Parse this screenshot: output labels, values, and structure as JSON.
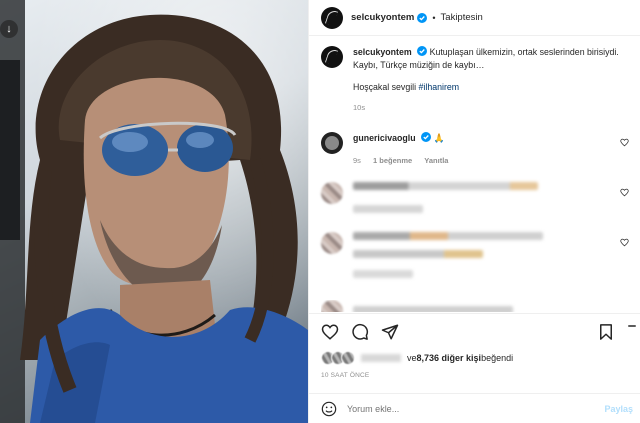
{
  "header": {
    "username": "selcukyontem",
    "separator": "•",
    "follow_label": "Takiptesin",
    "avatar_icon": "signature-avatar",
    "verified_icon": "verified-badge-icon"
  },
  "caption": {
    "username": "selcukyontem",
    "text": "Kutuplaşan ülkemizin, ortak seslerinden birisiydi. Kaybı, Türkçe müziğin de kaybı…",
    "line2_prefix": "Hoşçakal sevgili ",
    "hashtag": "#ilhanirem",
    "time": "10s"
  },
  "comments": [
    {
      "username": "gunericivaoglu",
      "text": "🙏",
      "time": "9s",
      "likes": "1 beğenme",
      "reply_label": "Yanıtla"
    }
  ],
  "actions": {
    "like_icon": "heart-icon",
    "comment_icon": "comment-icon",
    "share_icon": "send-icon",
    "save_icon": "bookmark-icon",
    "more_icon": "more-icon"
  },
  "likes": {
    "connector": "ve ",
    "count_text": "8,736 diğer kişi",
    "suffix": " beğendi"
  },
  "timestamp": "10 SAAT ÖNCE",
  "add_comment": {
    "placeholder": "Yorum ekle...",
    "post_label": "Paylaş",
    "emoji_icon": "emoji-icon"
  },
  "colors": {
    "text": "#262626",
    "muted": "#8e8e8e",
    "link": "#00376b",
    "verified": "#0095f6",
    "post_disabled": "#b2dffc"
  }
}
